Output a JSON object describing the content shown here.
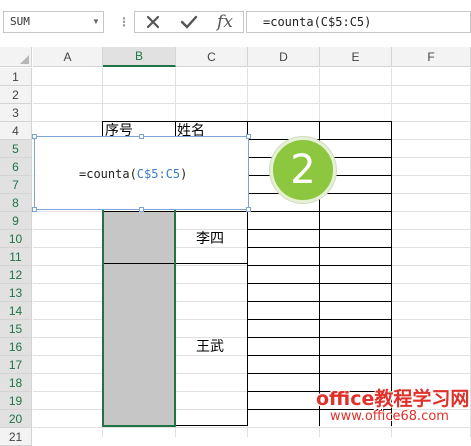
{
  "name_box": {
    "value": "SUM"
  },
  "formula_bar": {
    "separator": "⋮",
    "cancel_icon": "cancel-x-icon",
    "enter_icon": "checkmark-icon",
    "insert_function_label": "fx",
    "formula": "=counta(C$5:C5)"
  },
  "columns": [
    "A",
    "B",
    "C",
    "D",
    "E",
    "F"
  ],
  "rows": [
    "1",
    "2",
    "3",
    "4",
    "5",
    "6",
    "7",
    "8",
    "9",
    "10",
    "11",
    "12",
    "13",
    "14",
    "15",
    "16",
    "17",
    "18",
    "19",
    "20",
    "21"
  ],
  "selected_column": "B",
  "cells": {
    "B4": "序号",
    "C4": "姓名",
    "C9_11": "李四",
    "C12_20": "王武"
  },
  "edit_popup": {
    "prefix": "=counta(",
    "reference": "C$5:C5",
    "suffix": ")"
  },
  "step_badge": "2",
  "watermark": {
    "line1": "office教程学习网",
    "line2": "www.office68.com"
  },
  "colors": {
    "accent_green": "#217346",
    "selection_grey": "#c6c6c6",
    "badge_green": "#8dc63f",
    "reference_blue": "#3b79c8",
    "watermark_red": "#e0322b"
  }
}
